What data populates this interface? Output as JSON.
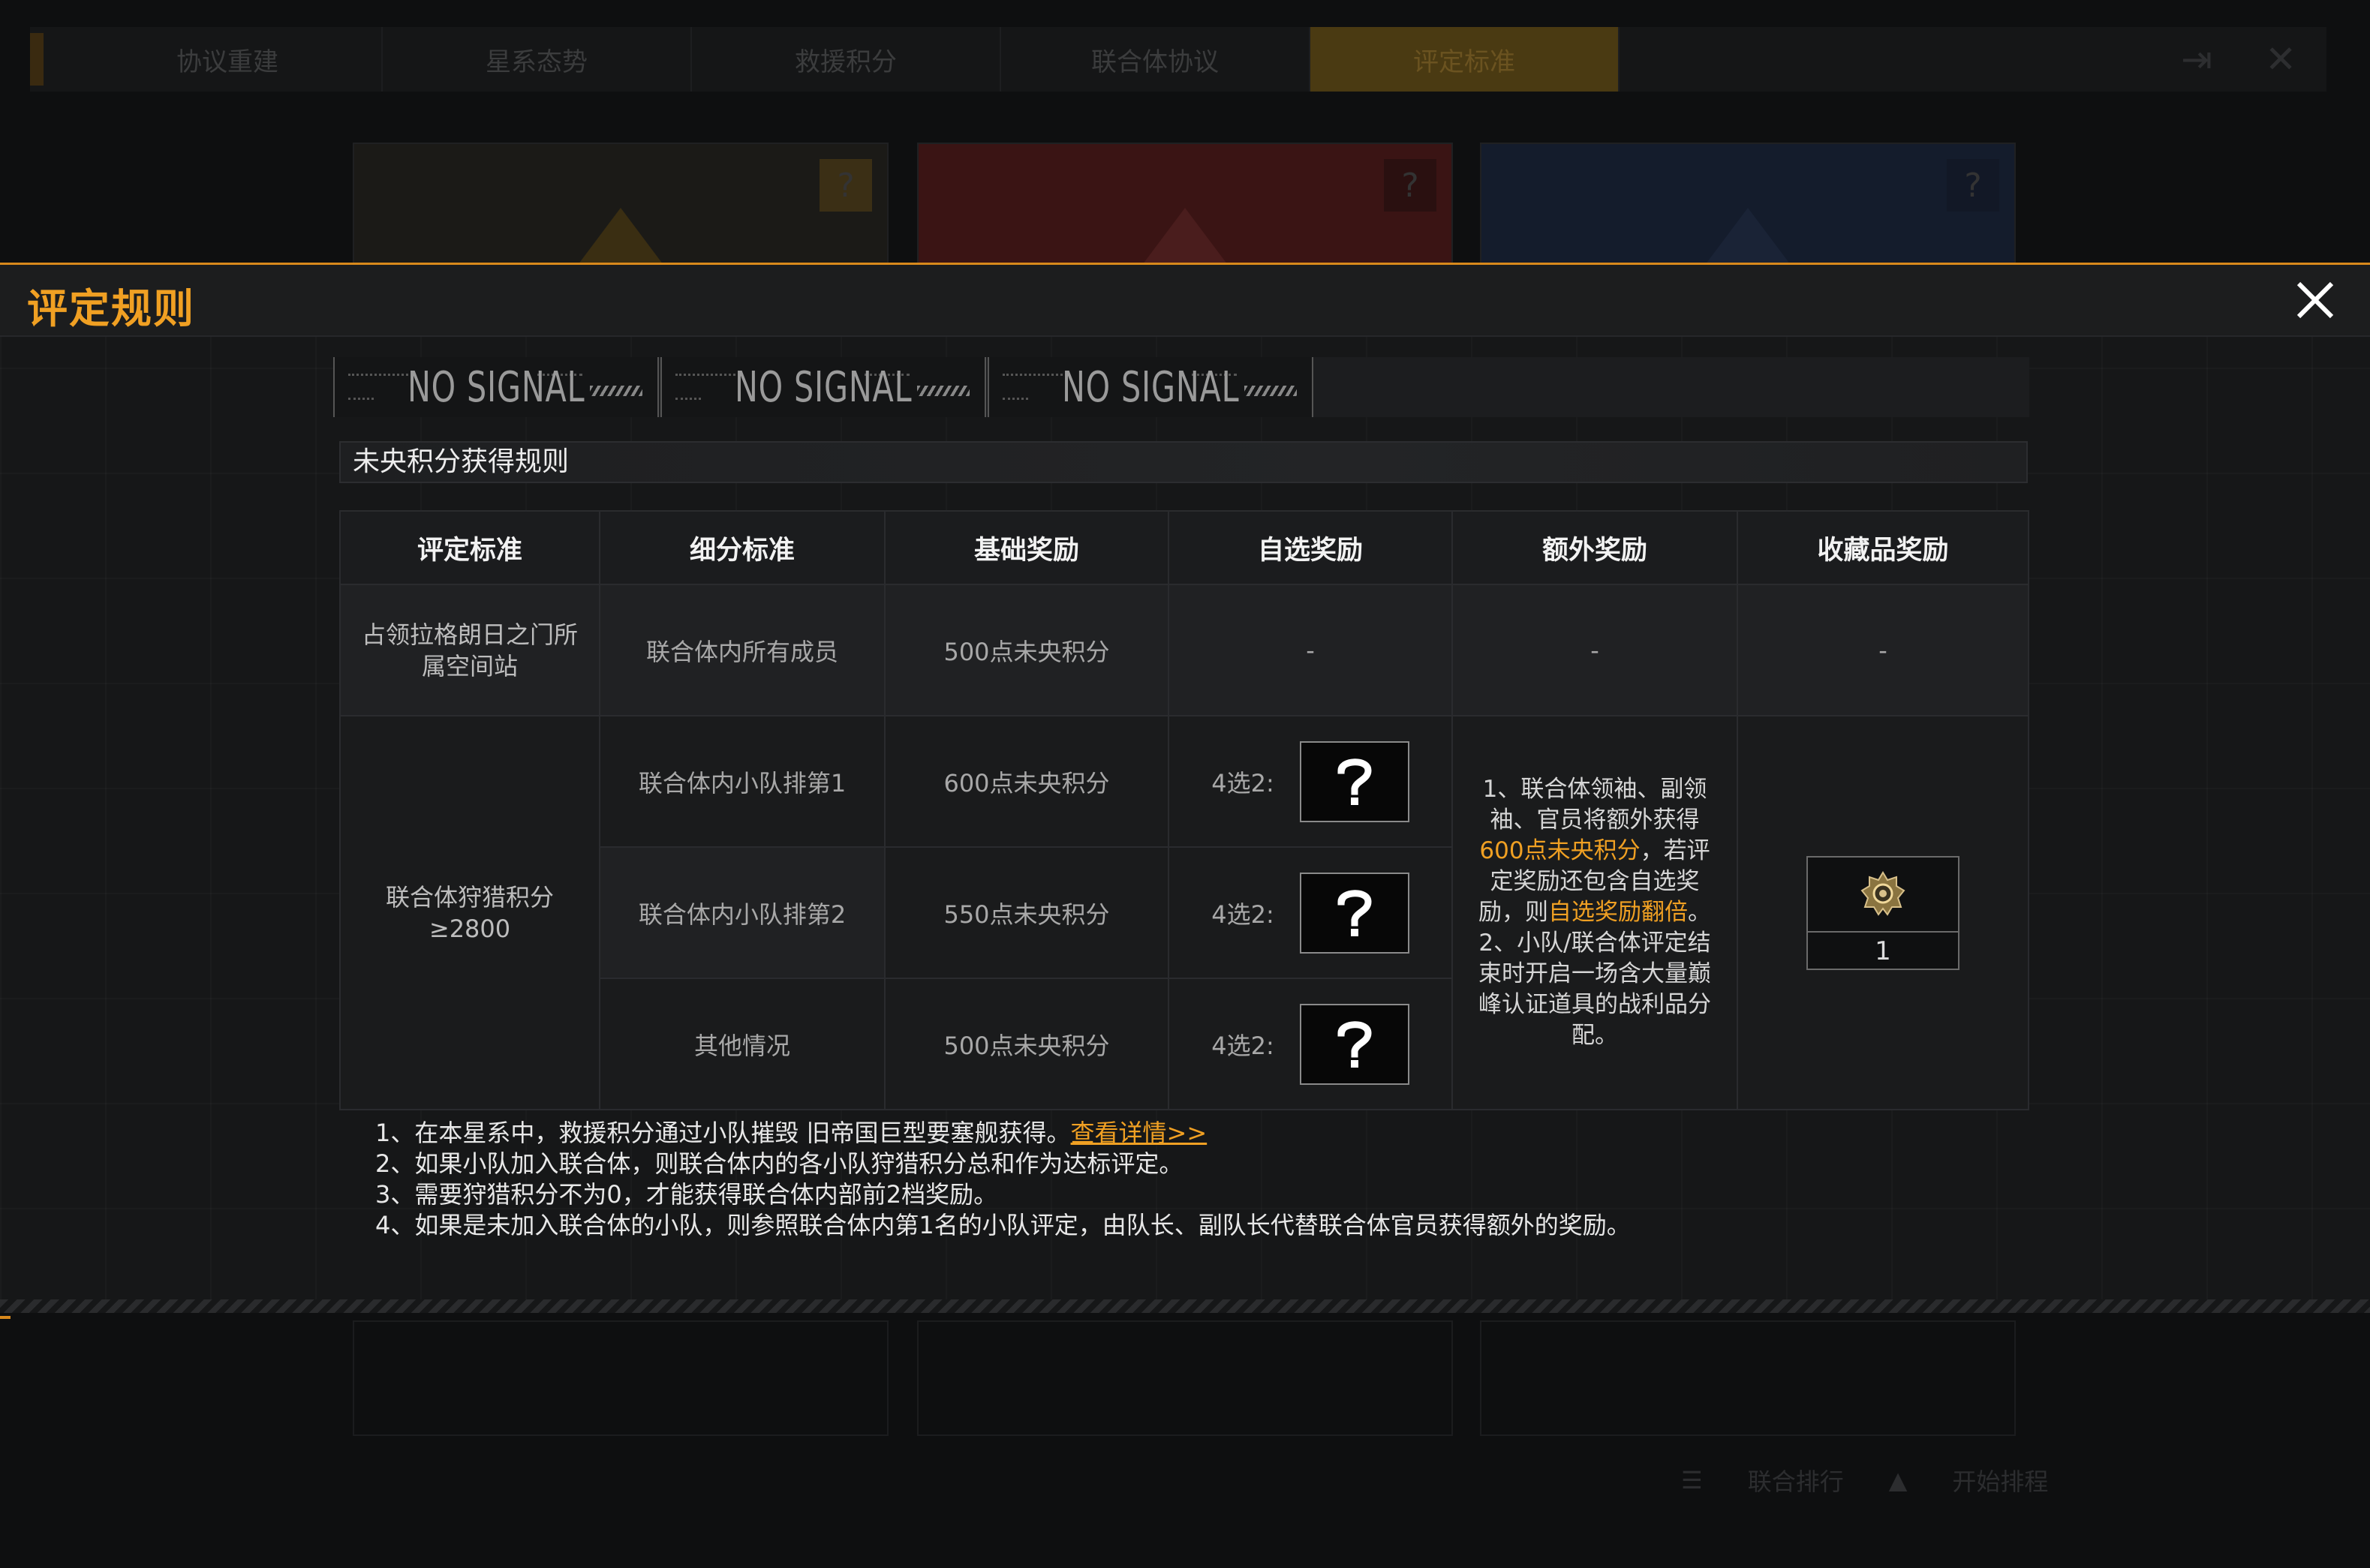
{
  "background": {
    "tabs": [
      "协议重建",
      "星系态势",
      "救援积分",
      "联合体协议",
      "评定标准"
    ],
    "active_tab": 4,
    "bottom_items": [
      "联合排行",
      "开始排程"
    ]
  },
  "modal": {
    "title": "评定规则",
    "signal_label": "NO SIGNAL",
    "signal_slots": 3,
    "section_title": "未央积分获得规则"
  },
  "table": {
    "headers": [
      "评定标准",
      "细分标准",
      "基础奖励",
      "自选奖励",
      "额外奖励",
      "收藏品奖励"
    ],
    "row1": {
      "criteria": "占领拉格朗日之门所属空间站",
      "sub": "联合体内所有成员",
      "base": "500点未央积分",
      "choice": "-",
      "extra": "-",
      "collect": "-"
    },
    "group2": {
      "criteria": "联合体狩猎积分≥2800",
      "rows": [
        {
          "sub": "联合体内小队排第1",
          "base": "600点未央积分",
          "choice_label": "4选2:"
        },
        {
          "sub": "联合体内小队排第2",
          "base": "550点未央积分",
          "choice_label": "4选2:"
        },
        {
          "sub": "其他情况",
          "base": "500点未央积分",
          "choice_label": "4选2:"
        }
      ],
      "extra": {
        "p1_a": "1、联合体领袖、副领袖、官员将额外获得",
        "p1_hl1": "600点未央积分",
        "p1_b": "，若评定奖励还包含自选奖励，则",
        "p1_hl2": "自选奖励翻倍",
        "p1_c": "。",
        "p2": "2、小队/联合体评定结束时开启一场含大量巅峰认证道具的战利品分配。"
      },
      "collect_count": "1"
    }
  },
  "notes": {
    "line1": "1、在本星系中，救援积分通过小队摧毁 旧帝国巨型要塞舰获得。",
    "line1_link": "查看详情>>",
    "line2": "2、如果小队加入联合体，则联合体内的各小队狩猎积分总和作为达标评定。",
    "line3": "3、需要狩猎积分不为0，才能获得联合体内部前2档奖励。",
    "line4": "4、如果是未加入联合体的小队，则参照联合体内第1名的小队评定，由队长、副队长代替联合体官员获得额外的奖励。"
  },
  "colors": {
    "accent": "#f0a023",
    "panel": "#161718"
  }
}
